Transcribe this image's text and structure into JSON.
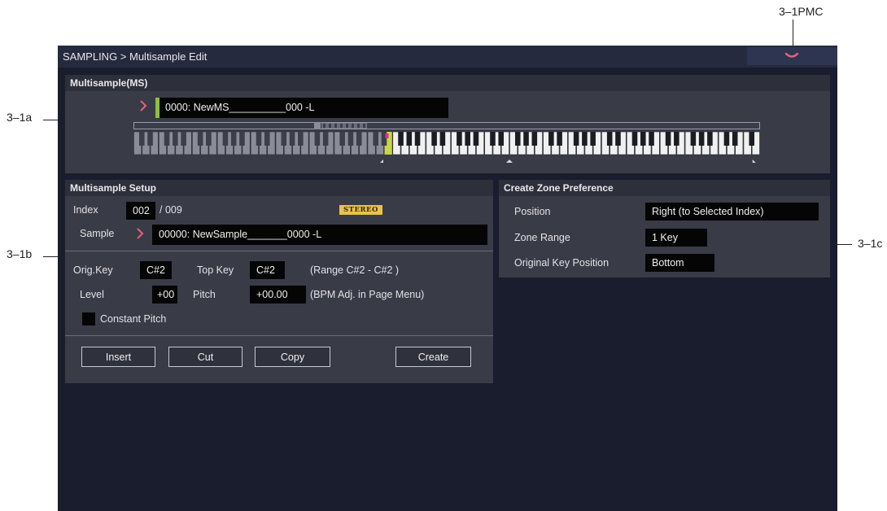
{
  "callouts": {
    "pmc": "3–1PMC",
    "a": "3–1a",
    "b": "3–1b",
    "c": "3–1c"
  },
  "window": {
    "title": "SAMPLING > Multisample Edit",
    "menu_icon": "chevron-down-icon"
  },
  "multisample": {
    "header": "Multisample(MS)",
    "ms_value": "0000: NewMS__________000 -L",
    "selected_key_color": "#c8d44a",
    "marker_color": "#e0308a"
  },
  "setup": {
    "header": "Multisample Setup",
    "index_label": "Index",
    "index_value": "002",
    "index_total": "/ 009",
    "stereo_badge": "STEREO",
    "sample_label": "Sample",
    "sample_value": "00000: NewSample_______0000 -L",
    "orig_key_label": "Orig.Key",
    "orig_key_value": "C#2",
    "top_key_label": "Top Key",
    "top_key_value": "C#2",
    "range_text": "(Range  C#2   - C#2   )",
    "level_label": "Level",
    "level_value": "+00",
    "pitch_label": "Pitch",
    "pitch_value": "+00.00",
    "bpm_note": "(BPM Adj. in Page Menu)",
    "constant_pitch_label": "Constant Pitch",
    "buttons": {
      "insert": "Insert",
      "cut": "Cut",
      "copy": "Copy",
      "create": "Create"
    }
  },
  "zone_pref": {
    "header": "Create Zone Preference",
    "position_label": "Position",
    "position_value": "Right (to Selected Index)",
    "zone_range_label": "Zone Range",
    "zone_range_value": "1 Key",
    "orig_key_pos_label": "Original Key Position",
    "orig_key_pos_value": "Bottom"
  },
  "colors": {
    "accent_arrow": "#e8607a",
    "ms_indicator": "#8fbf3a",
    "badge": "#e8c24a"
  }
}
